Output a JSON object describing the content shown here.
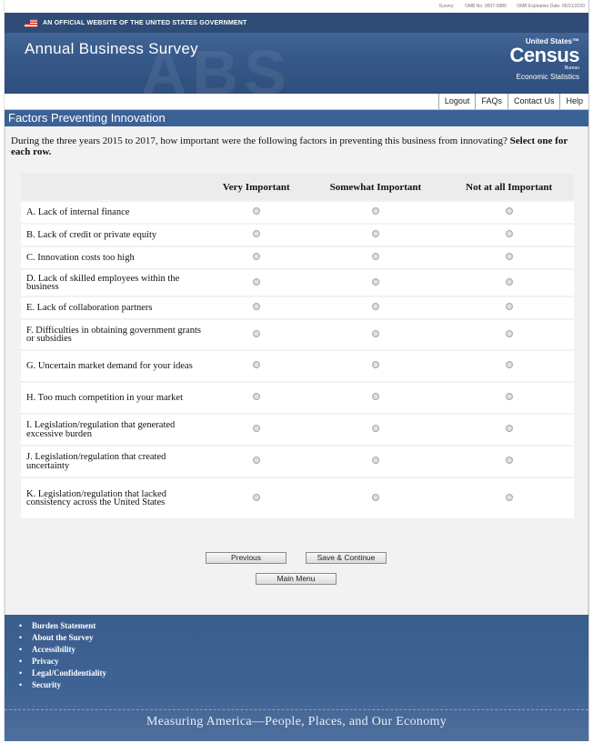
{
  "topbar": {
    "survey_label": "Survey:",
    "omb_no": "OMB No. 0607-0986",
    "omb_exp": "OMB Expiration Date: 05/31/2020"
  },
  "header": {
    "official_text": "AN OFFICIAL WEBSITE OF THE UNITED STATES GOVERNMENT",
    "title": "Annual Business Survey",
    "bg_letters": "ABS",
    "logo": {
      "united_states": "United States™",
      "census": "Census",
      "bureau": "Bureau",
      "econ": "Economic Statistics"
    }
  },
  "nav": {
    "logout": "Logout",
    "faqs": "FAQs",
    "contact": "Contact Us",
    "help": "Help"
  },
  "page": {
    "heading": "Factors Preventing Innovation",
    "question": "During the three years 2015 to 2017, how important were the following factors in preventing this business from innovating?",
    "instruction": "Select one for each row."
  },
  "table": {
    "headers": [
      "Very Important",
      "Somewhat Important",
      "Not at all Important"
    ],
    "rows": [
      "A. Lack of internal finance",
      "B. Lack of credit or private equity",
      "C. Innovation costs too high",
      "D. Lack of skilled employees within the business",
      "E. Lack of collaboration partners",
      "F. Difficulties in obtaining government grants or subsidies",
      "G. Uncertain market demand for your ideas",
      "H. Too much competition in your market",
      "I. Legislation/regulation that generated excessive burden",
      "J. Legislation/regulation that created uncertainty",
      "K. Legislation/regulation that lacked consistency across the United States"
    ]
  },
  "buttons": {
    "previous": "Previous",
    "save_continue": "Save & Continue",
    "main_menu": "Main Menu"
  },
  "footer": {
    "links": [
      "Burden Statement",
      "About the Survey",
      "Accessibility",
      "Privacy",
      "Legal/Confidentiality",
      "Security"
    ],
    "tagline": "Measuring America—People, Places, and Our Economy"
  },
  "colors": {
    "header_blue": "#36598a",
    "pagehead_blue": "#3b6196",
    "footer_blue": "#3f6394"
  }
}
